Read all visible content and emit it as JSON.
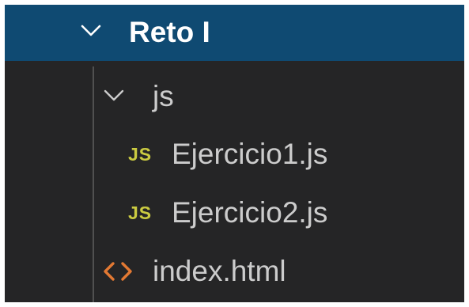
{
  "explorer": {
    "folder": {
      "label": "Reto I",
      "icon": "chevron-down-icon",
      "state": "expanded",
      "children": {
        "js_folder": {
          "label": "js",
          "icon": "chevron-down-icon",
          "state": "expanded",
          "files": [
            {
              "label": "Ejercicio1.js",
              "icon_text": "JS",
              "icon": "javascript-file-icon"
            },
            {
              "label": "Ejercicio2.js",
              "icon_text": "JS",
              "icon": "javascript-file-icon"
            }
          ]
        },
        "index_file": {
          "label": "index.html",
          "icon": "html-code-icon"
        }
      }
    },
    "colors": {
      "background": "#252526",
      "selected_row": "#0f4a72",
      "text": "#cccccc",
      "js_icon": "#cbcb41",
      "html_icon": "#e37933",
      "indent_guide": "#505050"
    }
  }
}
